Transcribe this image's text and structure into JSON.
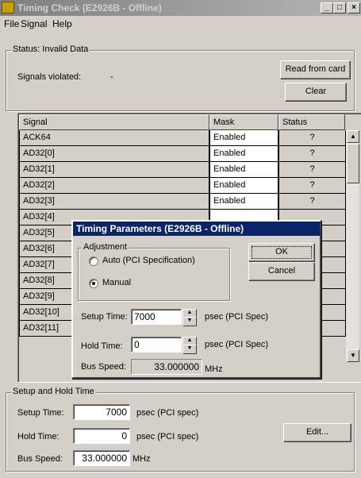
{
  "window": {
    "title": "Timing Check (E2926B - Offline)",
    "controls": {
      "minimize": "_",
      "maximize": "□",
      "close": "×"
    }
  },
  "menu": [
    "File",
    "Signal",
    "Help"
  ],
  "status": {
    "group_label": "Status: Invalid Data",
    "signals_violated_label": "Signals violated:",
    "signals_violated_value": "-",
    "read_button": "Read from card",
    "clear_button": "Clear"
  },
  "table": {
    "headers": [
      "Signal",
      "Mask",
      "Status"
    ],
    "rows": [
      {
        "signal": "ACK64",
        "mask": "Enabled",
        "status": "?"
      },
      {
        "signal": "AD32[0]",
        "mask": "Enabled",
        "status": "?"
      },
      {
        "signal": "AD32[1]",
        "mask": "Enabled",
        "status": "?"
      },
      {
        "signal": "AD32[2]",
        "mask": "Enabled",
        "status": "?"
      },
      {
        "signal": "AD32[3]",
        "mask": "Enabled",
        "status": "?"
      },
      {
        "signal": "AD32[4]",
        "mask": "",
        "status": ""
      },
      {
        "signal": "AD32[5]",
        "mask": "",
        "status": ""
      },
      {
        "signal": "AD32[6]",
        "mask": "",
        "status": ""
      },
      {
        "signal": "AD32[7]",
        "mask": "",
        "status": ""
      },
      {
        "signal": "AD32[8]",
        "mask": "",
        "status": ""
      },
      {
        "signal": "AD32[9]",
        "mask": "",
        "status": ""
      },
      {
        "signal": "AD32[10]",
        "mask": "",
        "status": ""
      },
      {
        "signal": "AD32[11]",
        "mask": "",
        "status": ""
      }
    ]
  },
  "dialog": {
    "title": "Timing Parameters (E2926B - Offline)",
    "adjustment_label": "Adjustment",
    "auto_label": "Auto (PCI Specification)",
    "manual_label": "Manual",
    "selected": "Manual",
    "ok_button": "OK",
    "cancel_button": "Cancel",
    "setup_label": "Setup Time:",
    "setup_value": "7000",
    "setup_unit": "psec  (PCI Spec)",
    "hold_label": "Hold Time:",
    "hold_value": "0",
    "hold_unit": "psec  (PCI Spec)",
    "bus_label": "Bus Speed:",
    "bus_value": "33.000000",
    "bus_unit": "MHz"
  },
  "setup_hold": {
    "group_label": "Setup and Hold Time",
    "setup_label": "Setup Time:",
    "setup_value": "7000",
    "setup_unit": "psec  (PCI spec)",
    "hold_label": "Hold Time:",
    "hold_value": "0",
    "hold_unit": "psec  (PCI spec)",
    "bus_label": "Bus Speed:",
    "bus_value": "33.000000",
    "bus_unit": "MHz",
    "edit_button": "Edit..."
  },
  "colors": {
    "title_inactive": "#808080",
    "dialog_title": "#0a246a",
    "face": "#d4d0c8"
  }
}
